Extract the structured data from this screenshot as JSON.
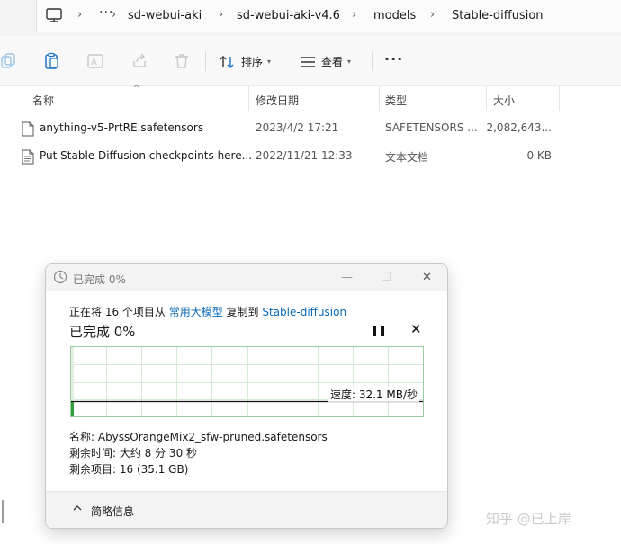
{
  "address_bar": {
    "more": "···",
    "breadcrumbs": [
      "sd-webui-aki",
      "sd-webui-aki-v4.6",
      "models",
      "Stable-diffusion"
    ]
  },
  "toolbar": {
    "sort_label": "排序",
    "view_label": "查看",
    "more": "···"
  },
  "file_list": {
    "columns": [
      "名称",
      "修改日期",
      "类型",
      "大小"
    ],
    "rows": [
      {
        "name": "anything-v5-PrtRE.safetensors",
        "modified": "2023/4/2 17:21",
        "type": "SAFETENSORS ...",
        "size": "2,082,643..."
      },
      {
        "name": "Put Stable Diffusion checkpoints here...",
        "modified": "2022/11/21 12:33",
        "type": "文本文档",
        "size": "0 KB"
      }
    ]
  },
  "dialog": {
    "title": "已完成 0%",
    "copy_prefix": "正在将 16 个项目从 ",
    "copy_source": "常用大模型",
    "copy_middle": " 复制到 ",
    "copy_dest": "Stable-diffusion",
    "percent_text": "已完成 0%",
    "progress_fraction": 0.0,
    "speed_text": "速度: 32.1 MB/秒",
    "name_line": "名称: AbyssOrangeMix2_sfw-pruned.safetensors",
    "time_line": "剩余时间: 大约 8 分 30 秒",
    "items_line": "剩余项目: 16 (35.1 GB)",
    "footer_label": "简略信息"
  },
  "watermark": "知乎 @已上岸",
  "colors": {
    "link": "#0b6ab8",
    "graph_border": "#9fc99f",
    "graph_fill": "#2e9e3e",
    "title_bar": "#f3f3f3"
  }
}
